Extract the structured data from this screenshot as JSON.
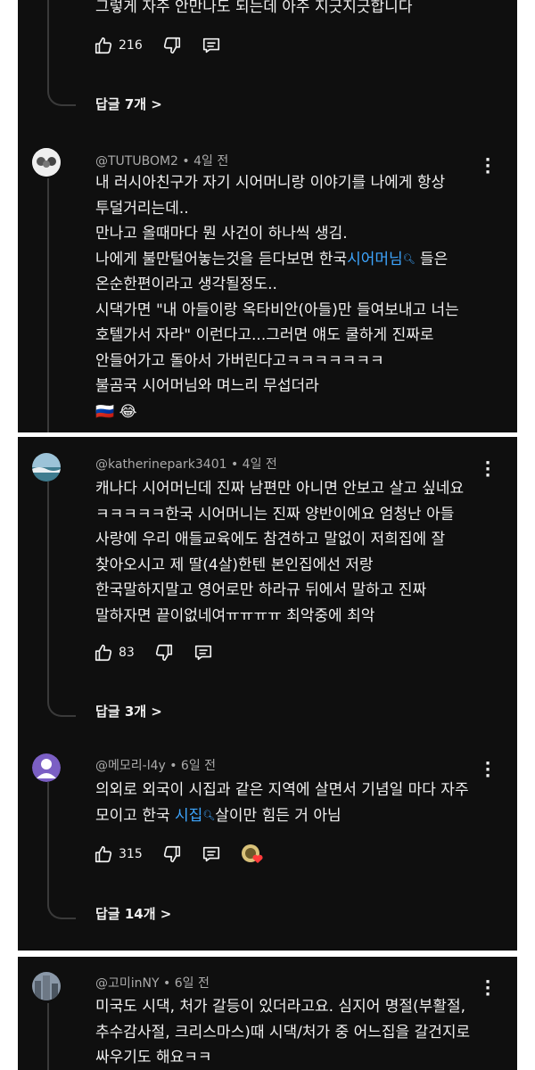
{
  "comment0": {
    "text_last": "그렇게 자주 안만나도 되는데 아주 지긋지긋합니다",
    "likes": "216",
    "replies": "답글 7개 >"
  },
  "comment1": {
    "author": "@TUTUBOM2 • 4일 전",
    "lines": [
      "내 러시아친구가 자기 시어머니랑 이야기를 나에게 항상",
      "투덜거리는데..",
      "만나고 올때마다 뭔 사건이 하나씩 생김.",
      "나에게 불만털어놓는것을 듣다보면 한국",
      "온순한편이라고 생각될정도..",
      "시댁가면 \"내 아들이랑 옥타비안(아들)만 들여보내고 너는",
      "호텔가서 자라\" 이런다고...그러면 얘도 쿨하게 진짜로",
      "안들어가고 돌아서 가버린다고ㅋㅋㅋㅋㅋㅋㅋ",
      "불곰국 시어머님와 며느리 무섭더라"
    ],
    "link_word": "시어머님",
    "after_link": "들은",
    "emoji": "🇷🇺 😂"
  },
  "comment2": {
    "author": "@katherinepark3401 • 4일 전",
    "lines": [
      "캐나다 시어머닌데 진짜 남편만 아니면 안보고 살고 싶네요",
      "ㅋㅋㅋㅋㅋ한국 시어머니는 진짜 양반이에요 엄청난 아들",
      "사랑에 우리 애들교육에도 참견하고 말없이 저희집에 잘",
      "찾아오시고 제 딸(4살)한텐 본인집에선 저랑",
      "한국말하지말고 영어로만 하라규 뒤에서 말하고 진짜",
      "말하자면 끝이없네여ㅠㅠㅠㅠ 최악중에 최악"
    ],
    "likes": "83",
    "replies": "답글 3개 >"
  },
  "comment3": {
    "author": "@메모리-l4y • 6일 전",
    "line1": "의외로 외국이 시집과 같은 지역에 살면서 기념일 마다 자주",
    "line2_pre": "모이고 한국",
    "link_word": "시집",
    "line2_post": "살이만 힘든 거 아님",
    "likes": "315",
    "replies": "답글 14개 >"
  },
  "comment4": {
    "author": "@고미inNY • 6일 전",
    "lines": [
      "미국도 시댁, 처가 갈등이 있더라고요. 심지어 명절(부활절,",
      "추수감사절, 크리스마스)때 시댁/처가 중 어느집을 갈건지로",
      "싸우기도 해요ㅋㅋ"
    ]
  }
}
